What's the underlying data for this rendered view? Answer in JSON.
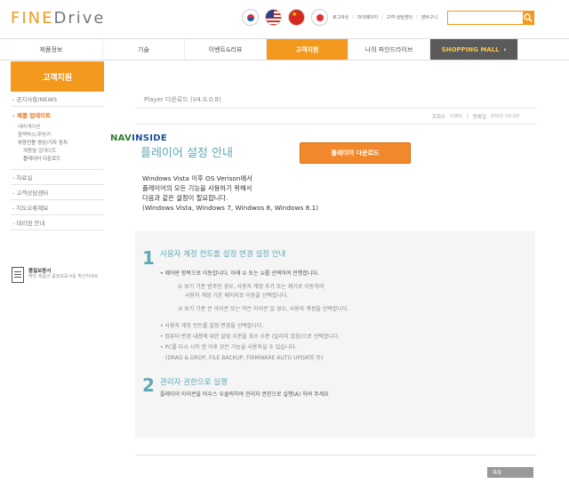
{
  "header": {
    "logo_brand": "FINE",
    "logo_suffix": "Drive",
    "flags": [
      "korea-flag-icon",
      "usa-flag-icon",
      "china-flag-icon",
      "japan-flag-icon"
    ],
    "top_links": [
      "로그아웃",
      "마이페이지",
      "고객 상담센터",
      "장바구니"
    ],
    "search_placeholder": ""
  },
  "nav": {
    "items": [
      "제품정보",
      "기술",
      "이벤트&리뷰",
      "고객지원",
      "나의 파인드라이브"
    ],
    "active_index": 3,
    "shopping_mall": "SHOPPING MALL",
    "shopping_mall_arrow": "›"
  },
  "sidebar": {
    "title": "고객지원",
    "menu_notice": "- 공지사항/NEWS",
    "menu_update": "- 제품 업데이트",
    "sub": [
      "내비게이션",
      "블랙박스/후방카",
      "차량전용 영상/기자 장치",
      "제품별 업데이트",
      "플레이어 다운로드"
    ],
    "menu_data": "- 자료실",
    "menu_center": "- 고객상담센터",
    "menu_map": "- 지도오류제보",
    "menu_dealer": "- 대리점 안내",
    "warranty_title": "품질보증서",
    "warranty_desc": "해당 제품의 품질보증서를 확인하세요"
  },
  "post": {
    "title": "Player 다운로드 (V4.0.0.8)",
    "views_label": "조회수",
    "views": "1082",
    "date_label": "등록일",
    "date": "2015-10-20"
  },
  "guide": {
    "brand_nav": "NAV",
    "brand_inside": "INSIDE",
    "title": "플레이어 설정 안내",
    "download_button": "플레이어 다운로드",
    "intro": [
      "Windows Vista 이후 OS Verison에서",
      "플레이어의 모든 기능을 사용하기 위해서",
      "다음과 같은 설정이 필요합니다.",
      "(Windows Vista, Windows 7, Windwos 8, Windows 8.1)"
    ],
    "step1_num": "1",
    "step1_title": "사용자 계정 컨트롤 설정 변경 설정 안내",
    "step1_lines": [
      "• 제어판 항목으로 이동합니다. 아래 ① 또는 ②를 선택하여 진행합니다.",
      "① 보기 기준 범주인 경우, 사용자 계정 추가 또는 제거로 이동하여",
      "사용자 계정 기본 페이지로 이동을 선택합니다.",
      "② 보기 기준 큰 아이콘 또는 작은 아이콘 일 경우, 사용자 계정을 선택합니다.",
      "• 사용자 계정 컨트롤 설정 변경을 선택합니다.",
      "• 컴퓨터 변경 내용에 대한 알림 수준을 최소 수준 (알리지 않음)으로 선택합니다.",
      "• PC를 다시 시작 한 이후 모든 기능을 사용하실 수 있습니다.",
      "(DRAG & DROP, FILE BACKUP, FIRMWARE AUTO UPDATE 등)"
    ],
    "step2_num": "2",
    "step2_title": "관리자 권한으로 실행",
    "step2_line": "플레이어 아이콘을 마우스 우클릭하여 관리자 권한으로 실행(A) 하여 주세요"
  },
  "footer": {
    "list_button": "목록"
  }
}
